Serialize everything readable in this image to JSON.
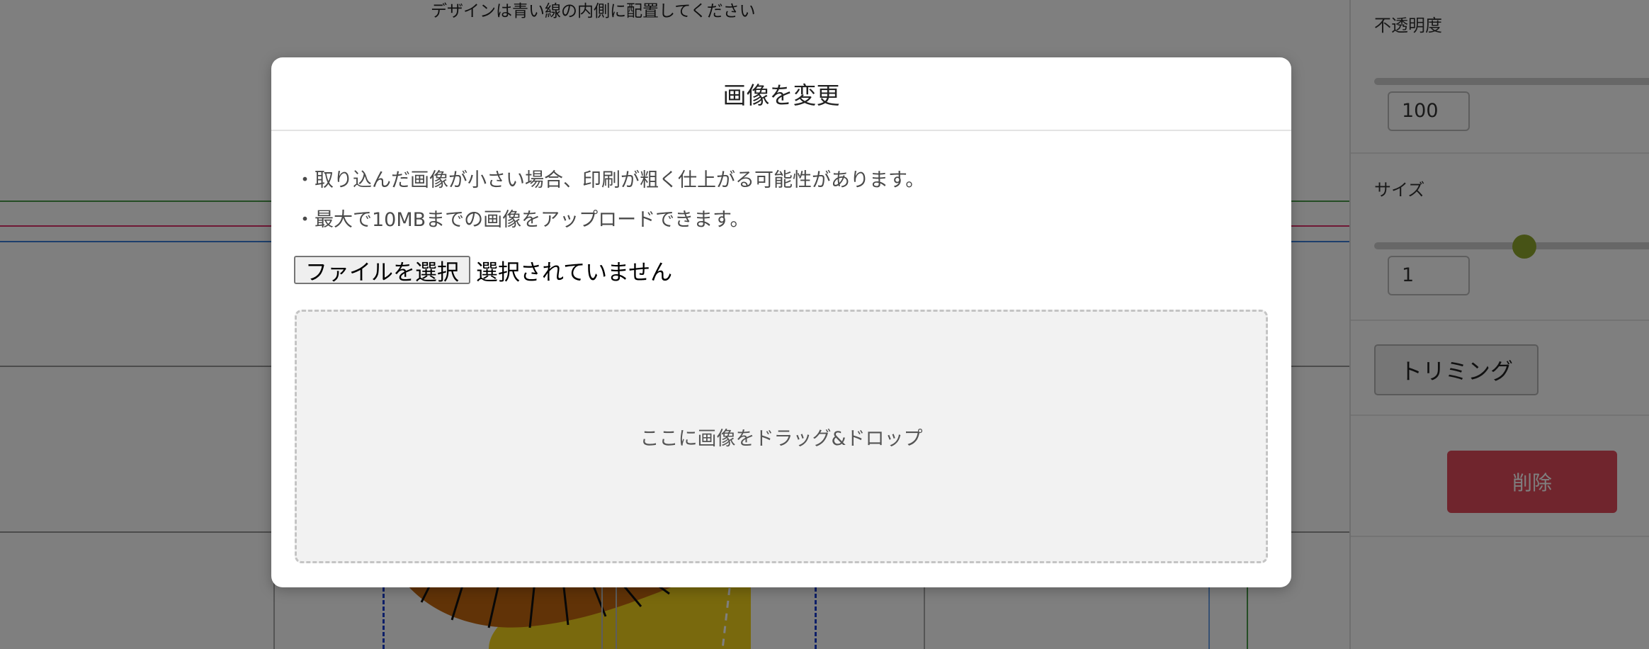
{
  "canvas": {
    "hint": "デザインは青い線の内側に配置してください"
  },
  "panel": {
    "opacity_label": "不透明度",
    "opacity_value": "100",
    "size_label": "サイズ",
    "size_value": "1",
    "trim_label": "トリミング",
    "delete_label": "削除",
    "slider_color": "#8ea62c",
    "delete_color": "#e04b5a"
  },
  "modal": {
    "title": "画像を変更",
    "notes": [
      "・取り込んだ画像が小さい場合、印刷が粗く仕上がる可能性があります。",
      "・最大で10MBまでの画像をアップロードできます。"
    ],
    "file_button": "ファイルを選択",
    "file_status": "選択されていません",
    "drop_label": "ここに画像をドラッグ&ドロップ"
  }
}
